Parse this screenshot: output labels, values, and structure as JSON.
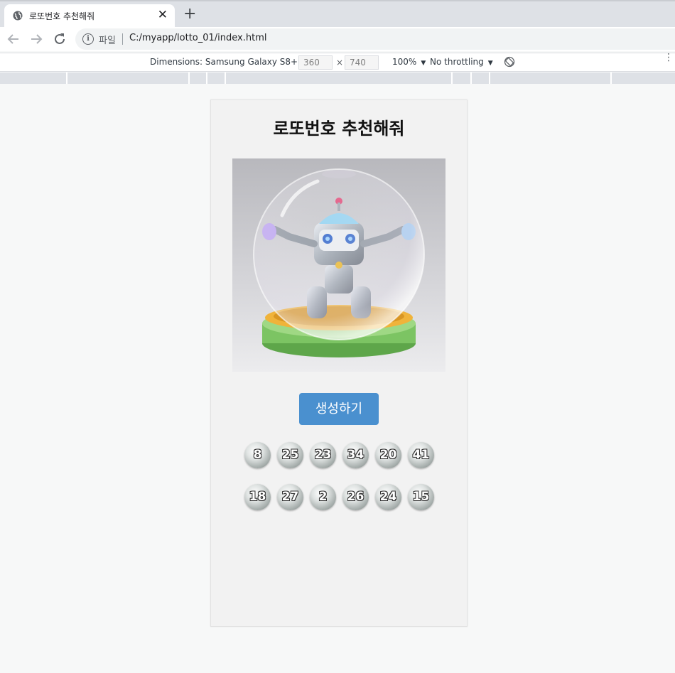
{
  "browser": {
    "tab_title": "로또번호 추천해줘",
    "tab_close": "✕",
    "new_tab": "+",
    "file_label": "파일",
    "url": "C:/myapp/lotto_01/index.html"
  },
  "devtools": {
    "dimensions_label": "Dimensions: Samsung Galaxy S8+",
    "width": "360",
    "height": "740",
    "times": "×",
    "zoom": "100%",
    "throttling": "No throttling",
    "caret": "▼",
    "more": "⋮"
  },
  "page": {
    "title": "로또번호 추천해줘",
    "button_label": "생성하기",
    "numbers_row1": [
      "8",
      "25",
      "23",
      "34",
      "20",
      "41"
    ],
    "numbers_row2": [
      "18",
      "27",
      "2",
      "26",
      "24",
      "15"
    ]
  },
  "colors": {
    "button": "#4a90cf",
    "page_bg": "#f2f2f2"
  },
  "icons": {
    "tab": "globe-icon",
    "back": "arrow-back-icon",
    "forward": "arrow-forward-icon",
    "reload": "reload-icon",
    "info": "info-icon",
    "rotate": "rotate-icon"
  }
}
